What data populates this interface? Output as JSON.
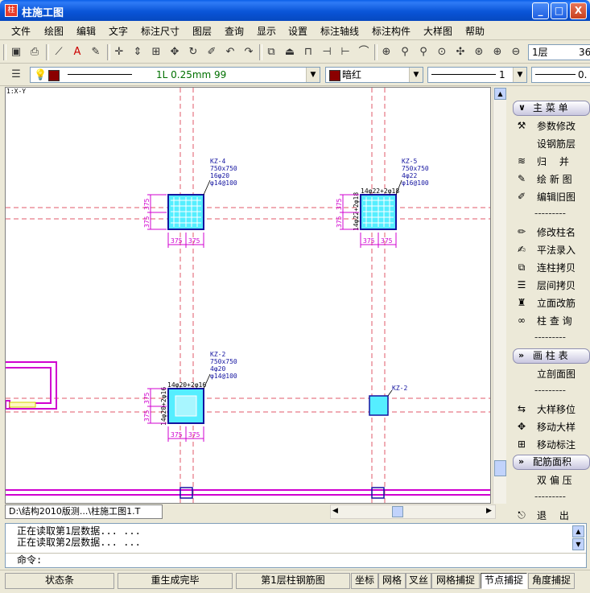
{
  "window": {
    "title": "柱施工图",
    "min": "_",
    "max": "□",
    "close": "X"
  },
  "menu": [
    "文件",
    "绘图",
    "编辑",
    "文字",
    "标注尺寸",
    "图层",
    "查询",
    "显示",
    "设置",
    "标注轴线",
    "标注构件",
    "大样图",
    "帮助"
  ],
  "toolbar2": {
    "layer_combo": "1层",
    "layer_combo_extra": "36"
  },
  "toolbar3": {
    "line_style": "1L 0.25mm 99",
    "color_combo": "暗红",
    "lineweight_combo": "1",
    "linetype_combo": "0."
  },
  "canvas": {
    "corner_label": "1:X-Y",
    "columns": [
      {
        "id": "KZ-4",
        "size": "750x750",
        "main": "16φ20",
        "stirrup": "φ14@100"
      },
      {
        "id": "KZ-5",
        "size": "750x750",
        "main": "4φ22",
        "stirrup": "φ16@100",
        "side_top": "14φ22+2φ18",
        "side_left": "14φ22+2φ18"
      },
      {
        "id": "KZ-2",
        "size": "750x750",
        "main": "4φ20",
        "stirrup": "φ14@100",
        "side_top": "14φ20+2φ16",
        "side_left": "14φ20+2φ16"
      },
      {
        "id": "KZ-2"
      }
    ],
    "dim": "375"
  },
  "file_tab": "D:\\结构2010版测...\\柱施工图1.T",
  "right_panel": {
    "main_header": "主 菜 单",
    "main_items": [
      "参数修改",
      "设钢筋层",
      "归　 并",
      "绘 新 图",
      "编辑旧图",
      "---------",
      "修改柱名",
      "平法录入",
      "连柱拷贝",
      "层间拷贝",
      "立面改筋",
      "柱 查 询",
      "---------"
    ],
    "table_header": "画 柱 表",
    "table_items": [
      "立剖面图",
      "---------",
      "大样移位",
      "移动大样",
      "移动标注"
    ],
    "area_header": "配筋面积",
    "area_items": [
      "双 偏 压",
      "---------",
      "退　 出"
    ]
  },
  "command": {
    "lines": [
      "正在读取第1层数据... ...",
      "正在读取第2层数据... ..."
    ],
    "prompt": "命令:"
  },
  "statusbar": [
    "状态条",
    "重生成完毕",
    "第1层柱钢筋图",
    "坐标",
    "网格",
    "叉丝",
    "网格捕捉",
    "节点捕捉",
    "角度捕捉"
  ],
  "colors": {
    "grid": "#E05A6A",
    "column_fill": "#55EEFF",
    "column_edge": "#1414A0",
    "dim": "#D000D0",
    "wall": "#D000D0",
    "title_bar": "#0A55D8"
  }
}
